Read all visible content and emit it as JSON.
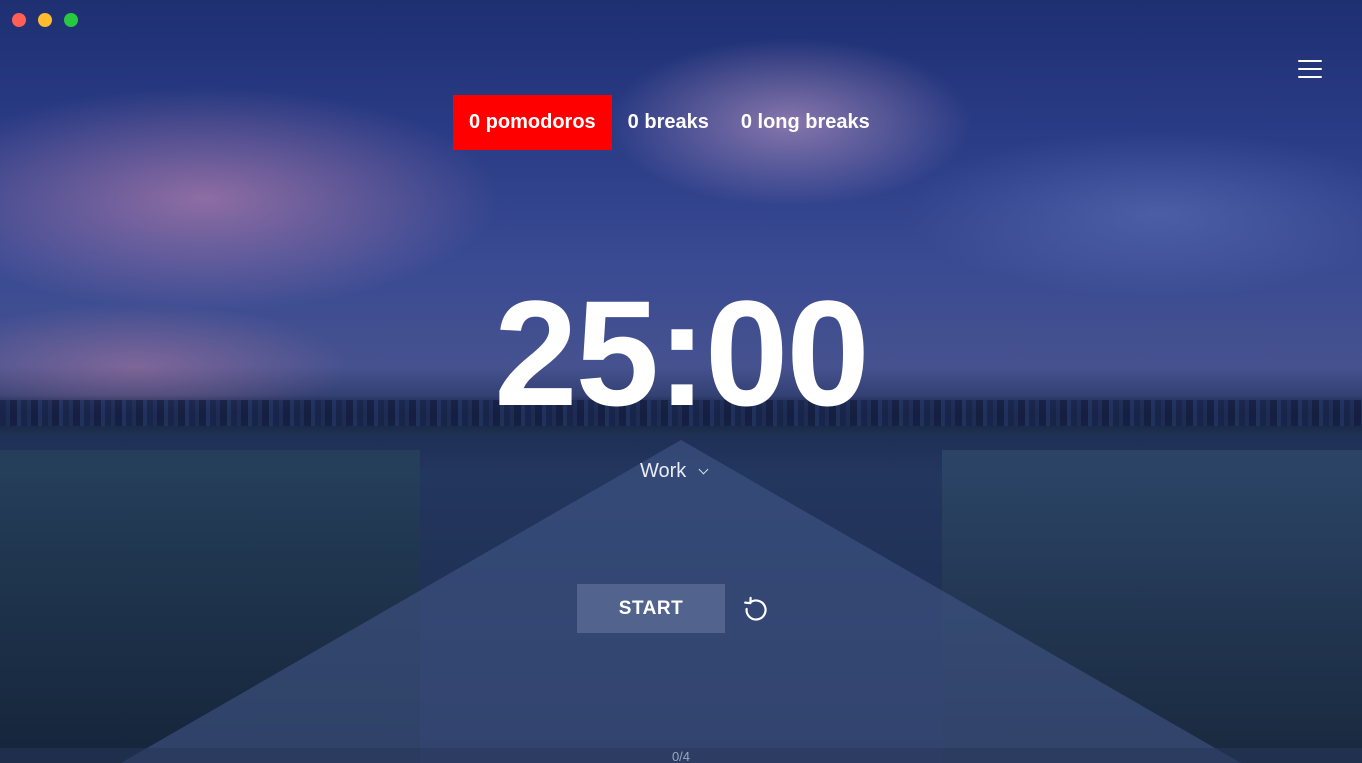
{
  "window": {
    "controls": [
      {
        "name": "close",
        "color": "#ff5f57"
      },
      {
        "name": "minimize",
        "color": "#febc2e"
      },
      {
        "name": "zoom",
        "color": "#28c840"
      }
    ]
  },
  "header": {
    "menu_icon": "hamburger-menu-icon"
  },
  "modes": {
    "tabs": [
      {
        "label": "0 pomodoros",
        "active": true
      },
      {
        "label": "0 breaks",
        "active": false
      },
      {
        "label": "0 long breaks",
        "active": false
      }
    ],
    "active_color": "#ff0000"
  },
  "timer": {
    "display": "25:00"
  },
  "task": {
    "selected": "Work",
    "icon": "chevron-down-icon"
  },
  "controls": {
    "start_label": "START",
    "reset_icon": "reset-icon"
  },
  "progress": {
    "label": "0/4",
    "completed": 0,
    "total": 4
  }
}
